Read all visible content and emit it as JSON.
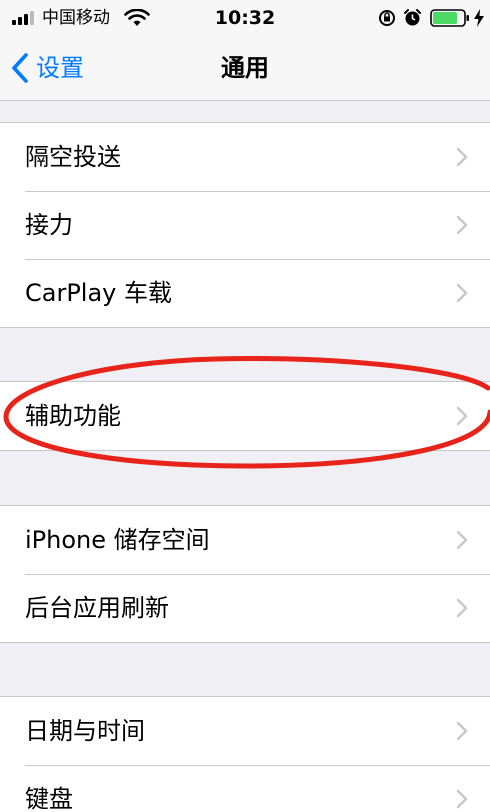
{
  "status_bar": {
    "carrier": "中国移动",
    "time": "10:32",
    "battery_level": 0.8,
    "battery_color": "#4cd964"
  },
  "nav": {
    "back_label": "设置",
    "title": "通用",
    "accent_color": "#007aff"
  },
  "groups": [
    {
      "rows": [
        {
          "label": "隔空投送"
        },
        {
          "label": "接力"
        },
        {
          "label": "CarPlay 车载"
        }
      ]
    },
    {
      "rows": [
        {
          "label": "辅助功能"
        }
      ]
    },
    {
      "rows": [
        {
          "label": "iPhone 储存空间"
        },
        {
          "label": "后台应用刷新"
        }
      ]
    },
    {
      "rows": [
        {
          "label": "日期与时间"
        },
        {
          "label": "键盘"
        }
      ]
    }
  ],
  "annotation": {
    "color": "#e8231a",
    "icon": "red-ellipse-highlight"
  }
}
